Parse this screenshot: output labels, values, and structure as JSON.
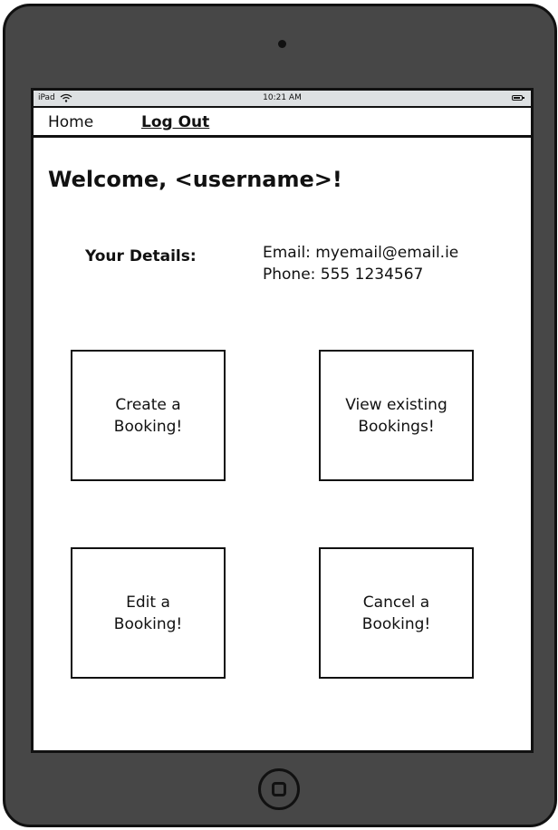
{
  "status_bar": {
    "device": "iPad",
    "time": "10:21 AM"
  },
  "nav": {
    "home": "Home",
    "logout": "Log Out"
  },
  "welcome": "Welcome, <username>!",
  "details": {
    "label": "Your Details:",
    "email": "Email: myemail@email.ie",
    "phone": "Phone: 555 1234567"
  },
  "tiles": {
    "create": "Create a\nBooking!",
    "view": "View existing\nBookings!",
    "edit": "Edit a\nBooking!",
    "cancel": "Cancel a\nBooking!"
  }
}
